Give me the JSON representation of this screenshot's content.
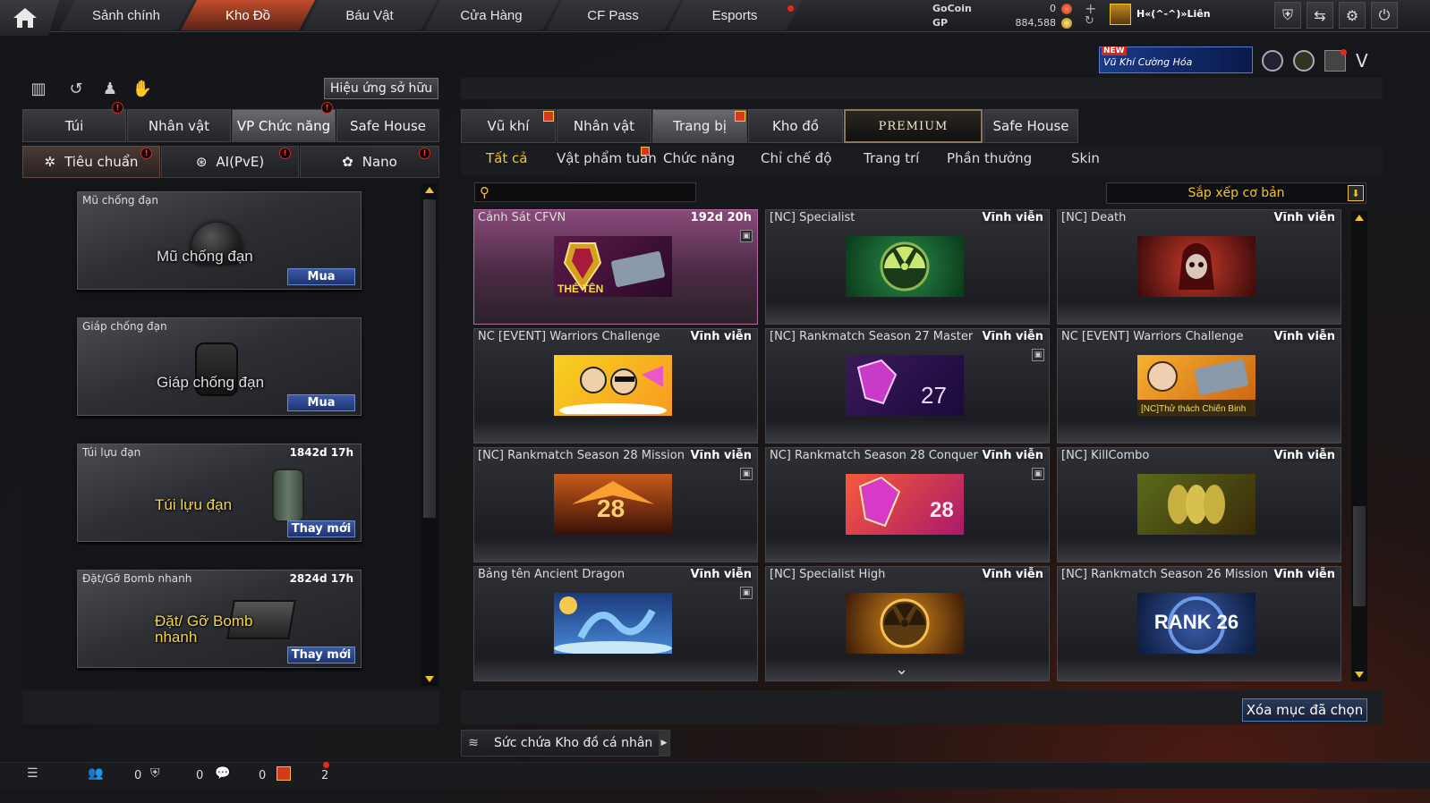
{
  "topnav": {
    "tabs": [
      {
        "label": "Sảnh chính"
      },
      {
        "label": "Kho Đồ",
        "active": true
      },
      {
        "label": "Báu Vật"
      },
      {
        "label": "Cửa Hàng"
      },
      {
        "label": "CF Pass"
      },
      {
        "label": "Esports"
      }
    ]
  },
  "wallet": {
    "gocoin_label": "GoCoin",
    "gocoin_value": "0",
    "gp_label": "GP",
    "gp_value": "884,588"
  },
  "user": {
    "name": "H«(^-^)»Liên"
  },
  "promo": {
    "new_tag": "NEW",
    "text": "Vũ Khí Cường Hóa"
  },
  "left": {
    "effect_button": "Hiệu ứng sở hữu",
    "tabs": [
      "Túi",
      "Nhân vật",
      "VP Chức năng",
      "Safe House"
    ],
    "active_tab": "VP Chức năng",
    "subtabs": [
      "Tiêu chuẩn",
      "AI(PvE)",
      "Nano"
    ],
    "items": [
      {
        "title": "Mũ chống đạn",
        "time": "",
        "caption": "Mũ chống đạn",
        "button": "Mua"
      },
      {
        "title": "Giáp chống đạn",
        "time": "",
        "caption": "Giáp chống đạn",
        "button": "Mua"
      },
      {
        "title": "Túi lựu đạn",
        "time": "1842d 17h",
        "caption": "Túi lựu đạn",
        "button": "Thay mới"
      },
      {
        "title": "Đặt/Gỡ Bomb nhanh",
        "time": "2824d 17h",
        "caption": "Đặt/ Gỡ Bomb nhanh",
        "button": "Thay mới"
      }
    ]
  },
  "right": {
    "tabs": [
      "Vũ khí",
      "Nhân vật",
      "Trang bị",
      "Kho đồ",
      "PREMIUM",
      "Safe House"
    ],
    "active_tab": "Trang bị",
    "subtabs": [
      "Tất cả",
      "Vật phẩm tuần",
      "Chức năng",
      "Chỉ chế độ",
      "Trang trí",
      "Phần thưởng",
      "Skin"
    ],
    "active_subtab": "Tất cả",
    "search": {
      "value": "",
      "placeholder": ""
    },
    "sort_label": "Sắp xếp cơ bản",
    "cards": [
      {
        "name": "Cảnh Sát CFVN",
        "duration": "192d 20h",
        "art": "THẺ TÊN",
        "locked": true
      },
      {
        "name": "[NC] Specialist",
        "duration": "Vĩnh viễn",
        "art": "",
        "locked": false
      },
      {
        "name": "[NC] Death",
        "duration": "Vĩnh viễn",
        "art": "",
        "locked": false
      },
      {
        "name": "NC [EVENT] Warriors Challenge",
        "duration": "Vĩnh viễn",
        "art": "",
        "locked": false
      },
      {
        "name": "[NC] Rankmatch Season 27 Master",
        "duration": "Vĩnh viễn",
        "art": "27",
        "locked": true
      },
      {
        "name": "NC [EVENT] Warriors Challenge",
        "duration": "Vĩnh viễn",
        "art": "[NC]Thử thách Chiến Binh",
        "locked": false
      },
      {
        "name": "[NC] Rankmatch Season 28 Mission",
        "duration": "Vĩnh viễn",
        "art": "28",
        "locked": true
      },
      {
        "name": "NC] Rankmatch Season 28 Conquer",
        "duration": "Vĩnh viễn",
        "art": "28",
        "locked": true
      },
      {
        "name": "[NC] KillCombo",
        "duration": "Vĩnh viễn",
        "art": "",
        "locked": false
      },
      {
        "name": "Bảng tên Ancient Dragon",
        "duration": "Vĩnh viễn",
        "art": "",
        "locked": true
      },
      {
        "name": "[NC] Specialist High",
        "duration": "Vĩnh viễn",
        "art": "",
        "locked": false
      },
      {
        "name": "[NC] Rankmatch Season 26 Mission",
        "duration": "Vĩnh viễn",
        "art": "RANK 26",
        "locked": false
      }
    ],
    "delete_button": "Xóa mục đã chọn",
    "capacity_label": "Sức chứa Kho đồ cá nhân"
  },
  "bottombar": {
    "counts": [
      "0",
      "0",
      "0",
      "2"
    ]
  },
  "colors": {
    "accent_gold": "#f2c230",
    "nav_active": "#c14d2b",
    "highlight_card": "#8a4a7a",
    "button_blue": "#3a5aa8"
  }
}
